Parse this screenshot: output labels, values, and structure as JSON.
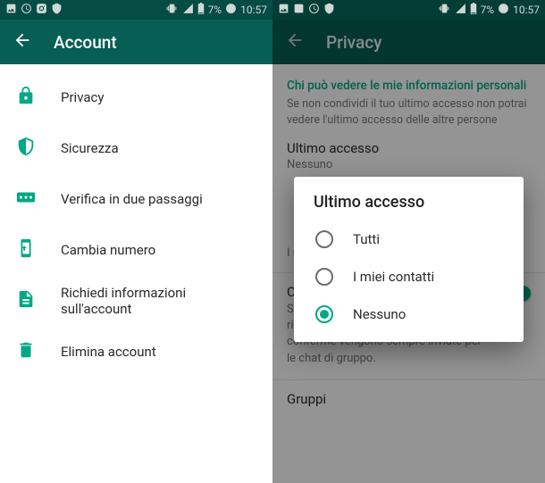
{
  "status": {
    "battery_text": "7%",
    "time": "10:57"
  },
  "left": {
    "app_bar_title": "Account",
    "items": [
      {
        "label": "Privacy"
      },
      {
        "label": "Sicurezza"
      },
      {
        "label": "Verifica in due passaggi"
      },
      {
        "label": "Cambia numero"
      },
      {
        "label": "Richiedi informazioni sull'account"
      },
      {
        "label": "Elimina account"
      }
    ]
  },
  "right": {
    "app_bar_title": "Privacy",
    "section_heading": "Chi può vedere le mie informazioni personali",
    "section_sub": "Se non condividi il tuo ultimo accesso non potrai vedere l'ultimo accesso delle altre persone",
    "last_seen_title": "Ultimo accesso",
    "last_seen_value": "Nessuno",
    "hidden_pref_value": "I miei contatti",
    "read_receipts_title": "Conferme di lettura",
    "read_receipts_desc": "Se disattivato, non potrai inviare o ricevere le conferme di lettura. Le conferme vengono sempre inviate per le chat di gruppo.",
    "groups_title": "Gruppi",
    "dialog": {
      "title": "Ultimo accesso",
      "options": [
        {
          "label": "Tutti",
          "selected": false
        },
        {
          "label": "I miei contatti",
          "selected": false
        },
        {
          "label": "Nessuno",
          "selected": true
        }
      ]
    }
  },
  "colors": {
    "brand": "#075e54",
    "accent": "#00a884"
  }
}
